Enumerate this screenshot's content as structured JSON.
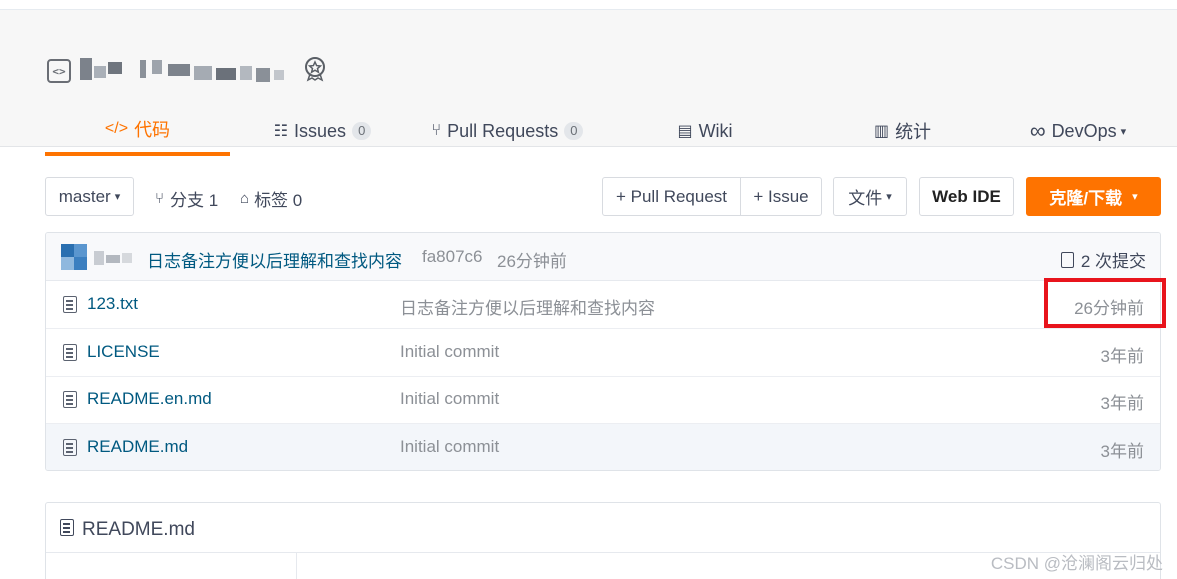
{
  "repo": {
    "name": ""
  },
  "tabs": [
    {
      "label": "代码",
      "icon": "code-icon"
    },
    {
      "label": "Issues",
      "icon": "issues-icon",
      "count": "0"
    },
    {
      "label": "Pull Requests",
      "icon": "pull-request-icon",
      "count": "0"
    },
    {
      "label": "Wiki",
      "icon": "book-icon"
    },
    {
      "label": "统计",
      "icon": "bar-chart-icon"
    },
    {
      "label": "DevOps",
      "icon": "infinity-icon",
      "caret": "▾"
    }
  ],
  "toolbar": {
    "branch": "master",
    "branch_caret": "▾",
    "branches_label": "分支 1",
    "tags_label": "标签 0",
    "pull_request_btn": "+ Pull Request",
    "issue_btn": "+ Issue",
    "files_btn": "文件",
    "files_caret": "▾",
    "webide_btn": "Web IDE",
    "clone_btn": "克隆/下载",
    "clone_caret": "▾"
  },
  "commit": {
    "message": "日志备注方便以后理解和查找内容",
    "hash": "fa807c6",
    "time": "26分钟前",
    "count_label": "2 次提交"
  },
  "files": [
    {
      "name": "123.txt",
      "message": "日志备注方便以后理解和查找内容",
      "time": "26分钟前"
    },
    {
      "name": "LICENSE",
      "message": "Initial commit",
      "time": "3年前"
    },
    {
      "name": "README.en.md",
      "message": "Initial commit",
      "time": "3年前"
    },
    {
      "name": "README.md",
      "message": "Initial commit",
      "time": "3年前"
    }
  ],
  "readme": {
    "title": "README.md"
  },
  "watermark": "CSDN @沧澜阁云归处",
  "colors": {
    "accent": "#fe7300",
    "highlight_box": "#e8141c",
    "link": "#005980"
  }
}
